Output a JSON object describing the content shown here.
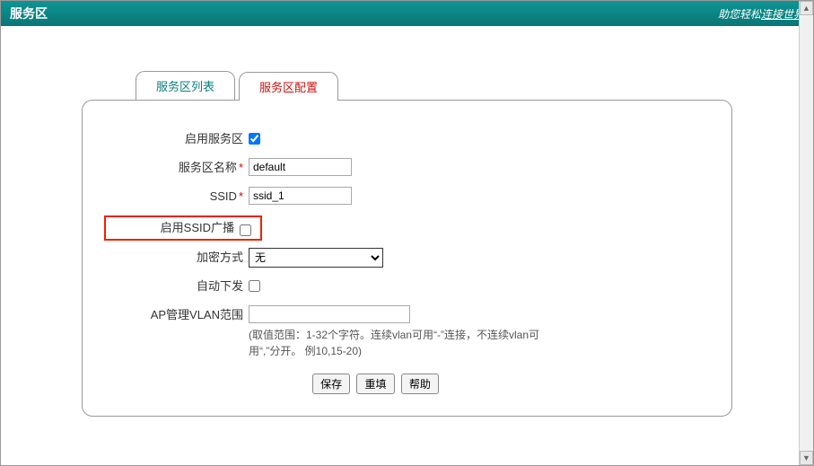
{
  "header": {
    "title": "服务区",
    "slogan_prefix": "助您轻松",
    "slogan_underlined": "连接世界"
  },
  "tabs": {
    "list_tab": "服务区列表",
    "config_tab": "服务区配置"
  },
  "form": {
    "enable_service_area": {
      "label": "启用服务区",
      "checked": true
    },
    "service_area_name": {
      "label": "服务区名称",
      "value": "default"
    },
    "ssid": {
      "label": "SSID",
      "value": "ssid_1"
    },
    "enable_ssid_broadcast": {
      "label": "启用SSID广播",
      "checked": false
    },
    "encryption": {
      "label": "加密方式",
      "value": "无"
    },
    "auto_deliver": {
      "label": "自动下发",
      "checked": false
    },
    "ap_vlan": {
      "label": "AP管理VLAN范围",
      "value": "",
      "note": "(取值范围：1-32个字符。连续vlan可用“-”连接，不连续vlan可用“,”分开。 例10,15-20)"
    }
  },
  "buttons": {
    "save": "保存",
    "reset": "重填",
    "help": "帮助"
  }
}
